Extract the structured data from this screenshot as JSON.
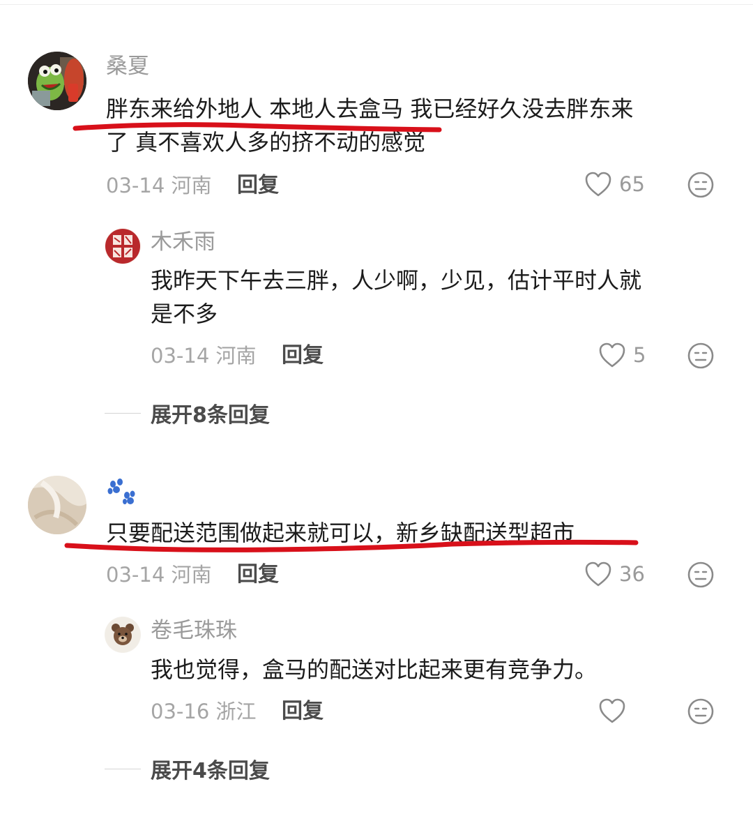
{
  "comments": [
    {
      "username": "桑夏",
      "text_line1": "胖东来给外地人 本地人去盒马 我已经好久没去胖东来",
      "text_line2": "了 真不喜欢人多的挤不动的感觉",
      "date": "03-14",
      "region": "河南",
      "reply_label": "回复",
      "likes": "65",
      "avatar_icon": "frog-avatar-icon",
      "reply": {
        "username": "木禾雨",
        "text_line1": "我昨天下午去三胖，人少啊，少见，估计平时人就",
        "text_line2": "是不多",
        "date": "03-14",
        "region": "河南",
        "reply_label": "回复",
        "likes": "5",
        "avatar_icon": "red-seal-avatar-icon"
      },
      "expand_label": "展开8条回复"
    },
    {
      "username": "🐾",
      "text_line1": "只要配送范围做起来就可以，新乡缺配送型超市",
      "date": "03-14",
      "region": "河南",
      "reply_label": "回复",
      "likes": "36",
      "avatar_icon": "fabric-avatar-icon",
      "reply": {
        "username": "卷毛珠珠",
        "text_line1": "我也觉得，盒马的配送对比起来更有竞争力。",
        "date": "03-16",
        "region": "浙江",
        "reply_label": "回复",
        "likes": "",
        "avatar_icon": "bear-avatar-icon"
      },
      "expand_label": "展开4条回复"
    }
  ],
  "icons": {
    "like": "heart-outline-icon",
    "dislike": "neutral-face-icon",
    "paw": "paw-print-icon"
  },
  "colors": {
    "highlight_stroke": "#d8101a",
    "username": "#9a9a9a",
    "text": "#1b1b1b"
  }
}
